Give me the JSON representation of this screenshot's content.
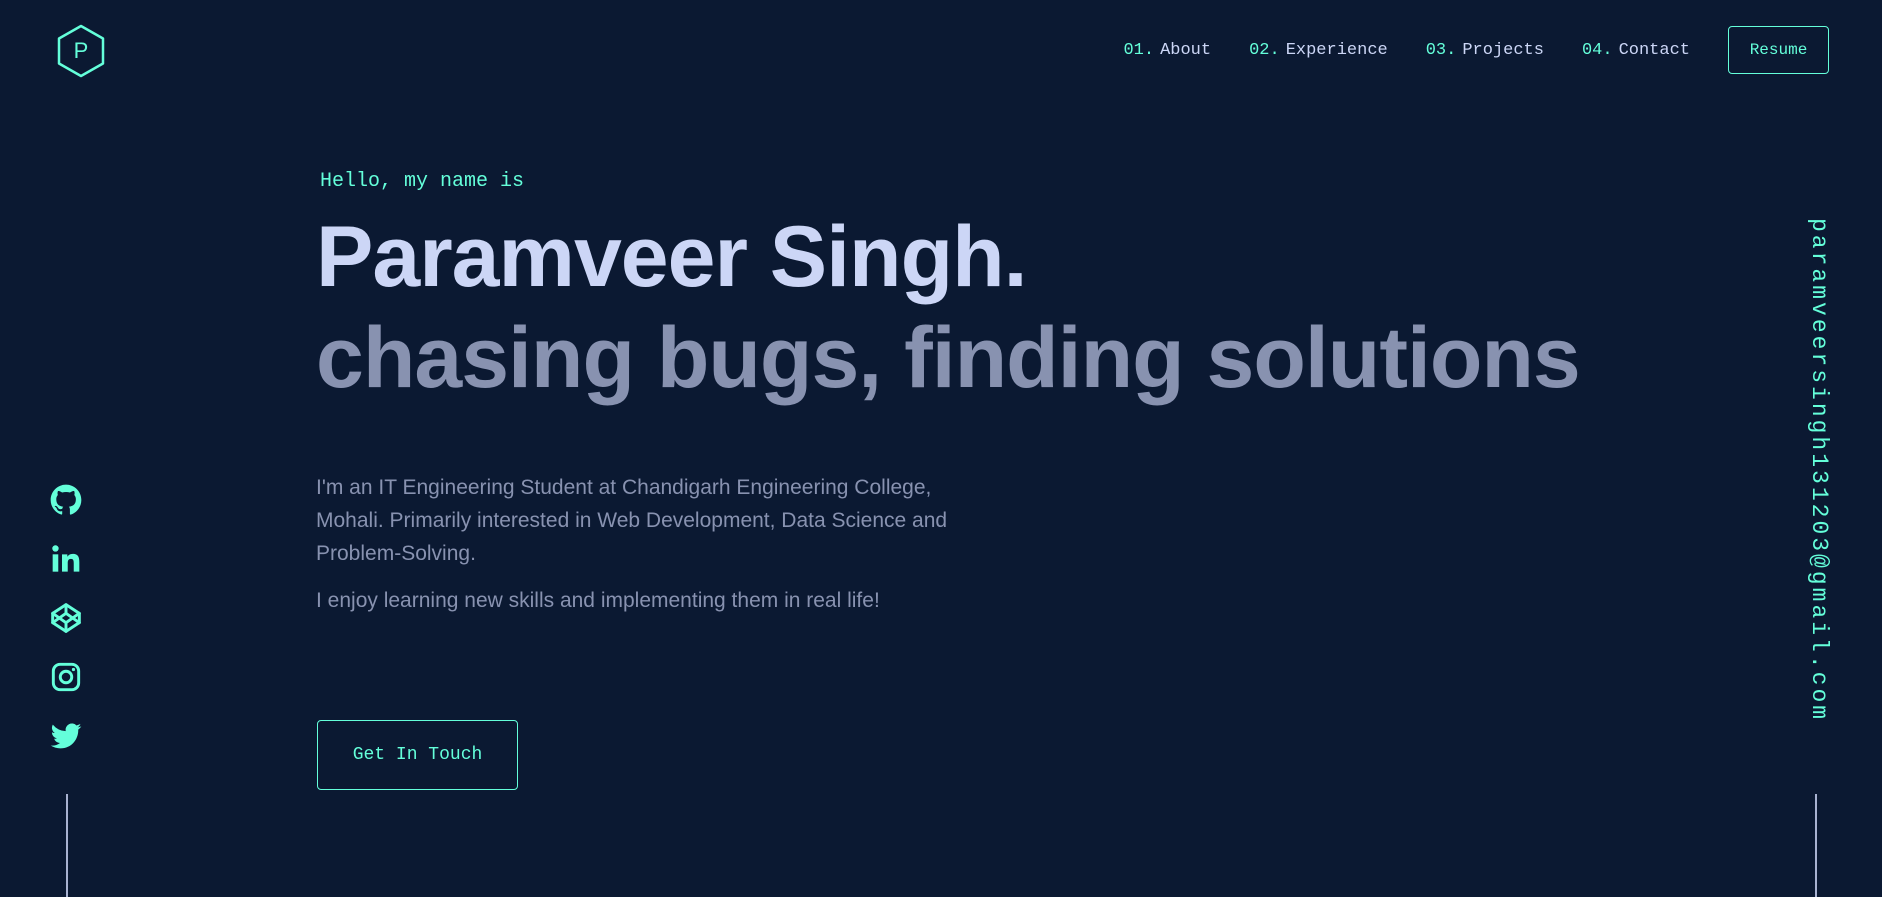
{
  "logo": {
    "letter": "P",
    "icon": "hexagon-logo-icon"
  },
  "nav": {
    "items": [
      {
        "num": "01.",
        "label": "About"
      },
      {
        "num": "02.",
        "label": "Experience"
      },
      {
        "num": "03.",
        "label": "Projects"
      },
      {
        "num": "04.",
        "label": "Contact"
      }
    ],
    "resume_label": "Resume"
  },
  "hero": {
    "intro": "Hello, my name is",
    "name": "Paramveer Singh.",
    "tagline": "chasing bugs, finding solutions",
    "description": "I'm an IT Engineering Student at Chandigarh Engineering College, Mohali. Primarily interested in Web Development, Data Science and Problem-Solving.",
    "description2": "I enjoy learning new skills and implementing them in real life!",
    "cta_label": "Get In Touch"
  },
  "socials": [
    {
      "icon": "github-icon"
    },
    {
      "icon": "linkedin-icon"
    },
    {
      "icon": "codepen-icon"
    },
    {
      "icon": "instagram-icon"
    },
    {
      "icon": "twitter-icon"
    }
  ],
  "email": "paramveersingh131203@gmail.com",
  "colors": {
    "background": "#0b1932",
    "accent": "#64ffda",
    "heading": "#ccd6f6",
    "body_text": "#8892b0"
  }
}
